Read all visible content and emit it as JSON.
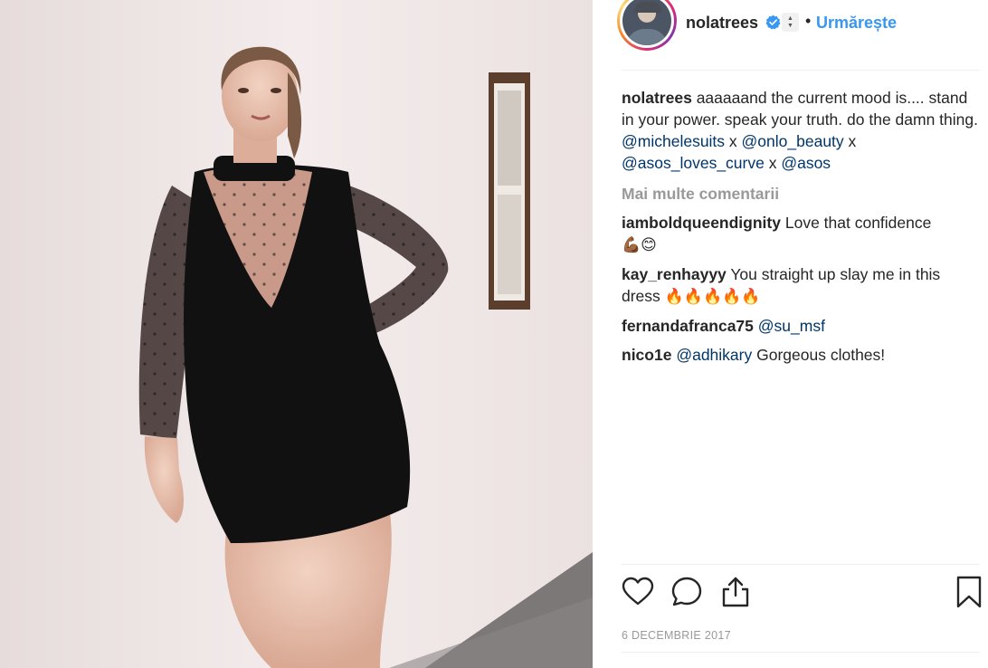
{
  "photo": {
    "alt": ""
  },
  "header": {
    "username": "nolatrees",
    "separator": "•",
    "follow_label": "Urmărește"
  },
  "caption": {
    "username": "nolatrees",
    "text": "aaaaaand the current mood is.... stand in your power. speak your truth. do the damn thing.",
    "mentions": [
      {
        "handle": "@michelesuits",
        "after": " x "
      },
      {
        "handle": "@onlo_beauty",
        "after": " x "
      },
      {
        "handle": "@asos_loves_curve",
        "after": " x "
      },
      {
        "handle": "@asos",
        "after": ""
      }
    ]
  },
  "more_comments_label": "Mai multe comentarii",
  "comments": [
    {
      "username": "iamboldqueendignity",
      "text": "Love that confidence",
      "emoji": "💪🏾😊"
    },
    {
      "username": "kay_renhayyy",
      "text": "You straight up slay me in this dress",
      "emoji": "🔥🔥🔥🔥🔥"
    },
    {
      "username": "fernandafranca75",
      "mention": "@su_msf",
      "text": ""
    },
    {
      "username": "nico1e",
      "mention": "@adhikary",
      "text": "Gorgeous clothes!"
    }
  ],
  "date": "6 DECEMBRIE 2017",
  "icons": {
    "like": "heart-icon",
    "comment": "comment-icon",
    "share": "share-icon",
    "save": "bookmark-icon",
    "verified": "verified-badge-icon"
  },
  "colors": {
    "link": "#3897f0",
    "mention": "#003569",
    "muted": "#999999",
    "text": "#262626"
  }
}
